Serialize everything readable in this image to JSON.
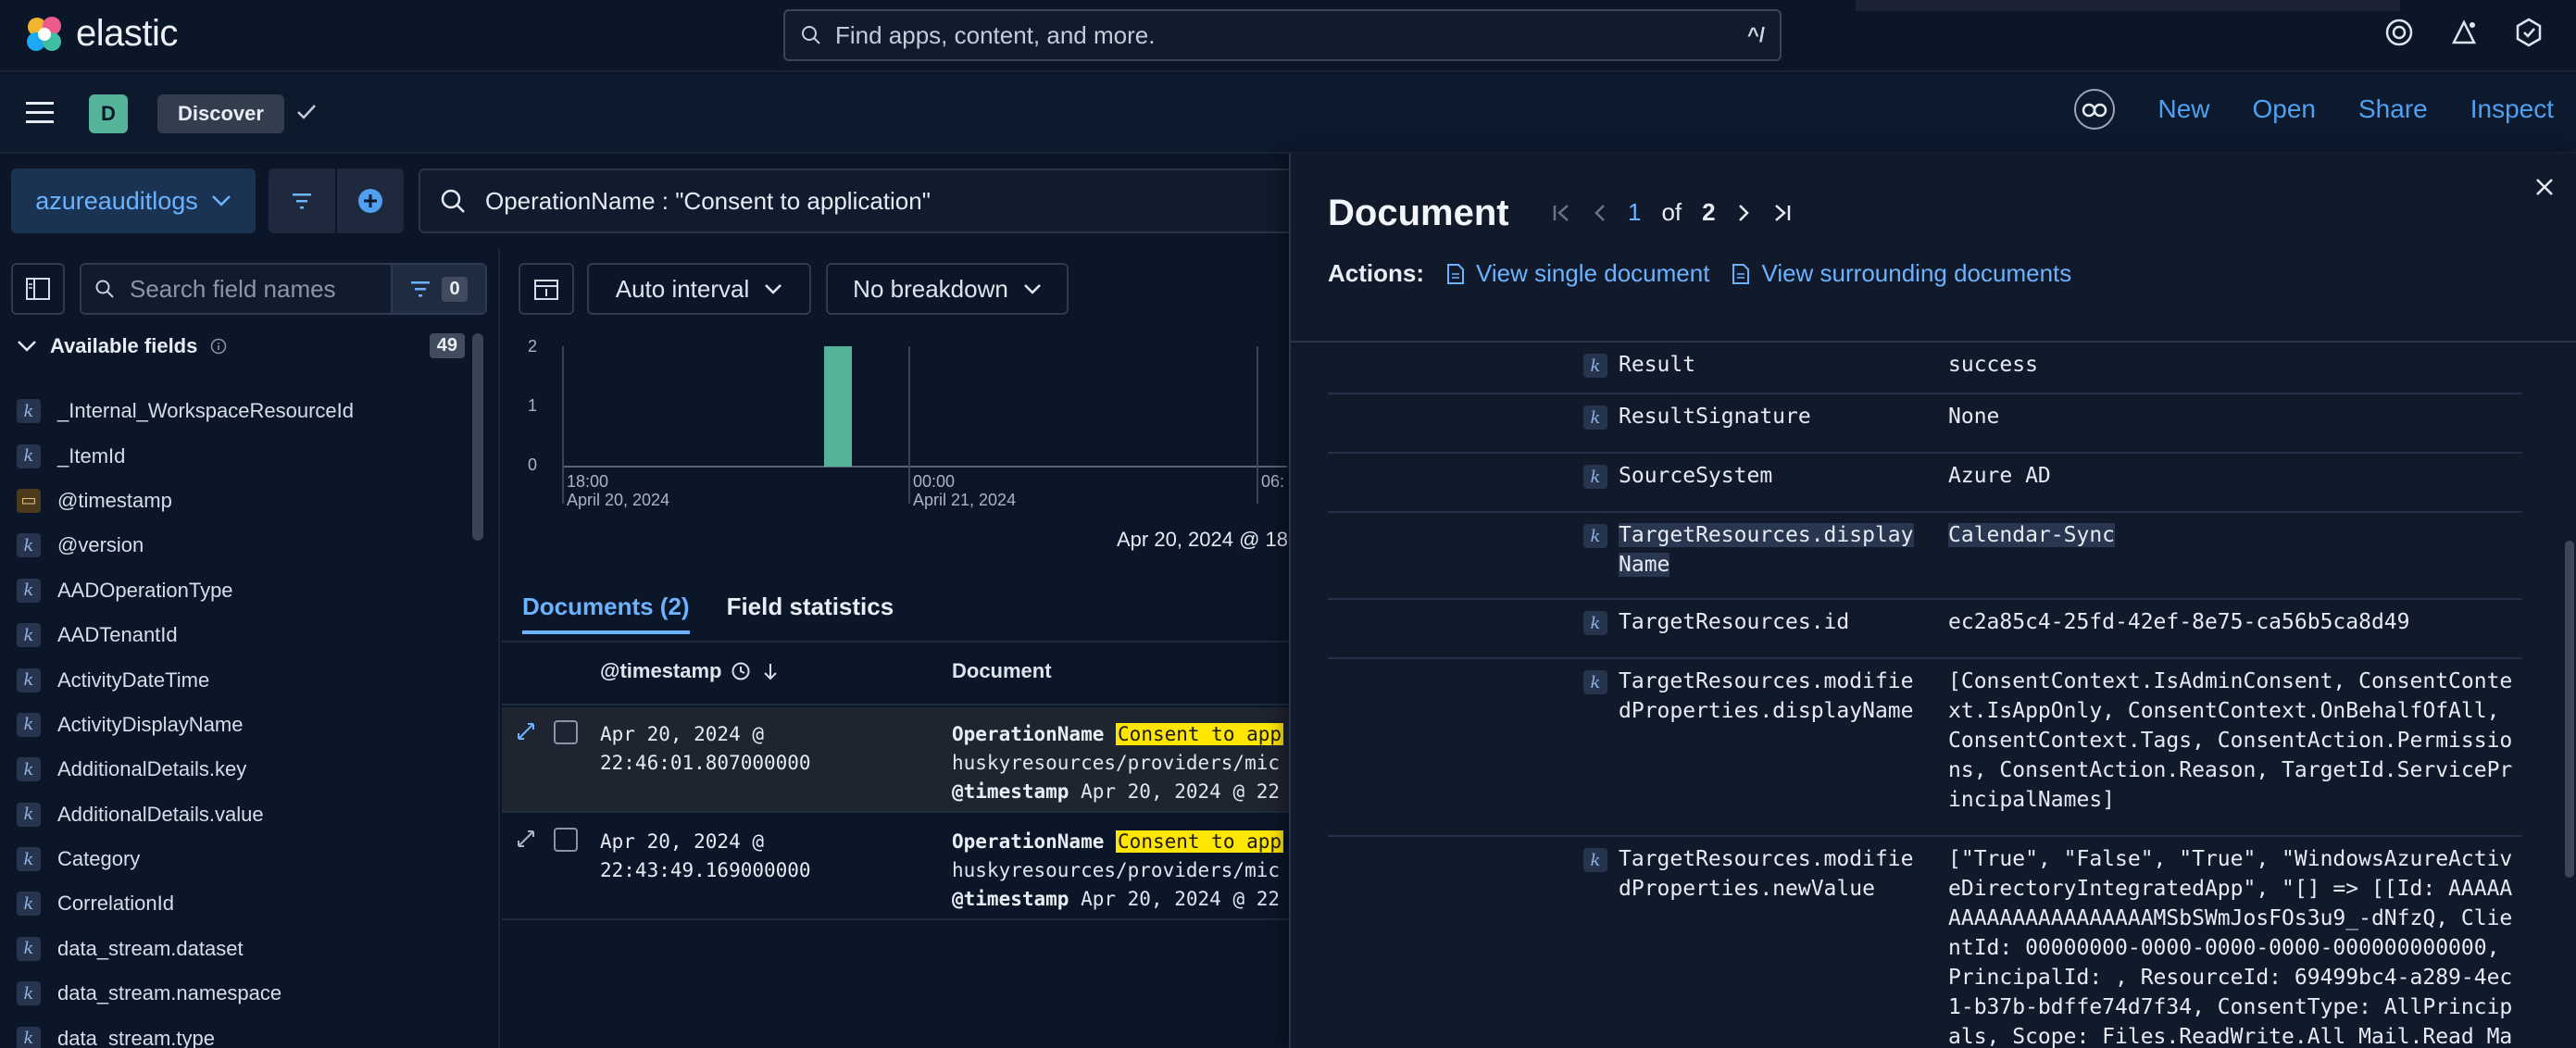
{
  "app": {
    "brand": "elastic",
    "global_search_placeholder": "Find apps, content, and more.",
    "global_search_shortcut": "^/"
  },
  "nav": {
    "space_initial": "D",
    "breadcrumb": "Discover"
  },
  "top_actions": {
    "new": "New",
    "open": "Open",
    "share": "Share",
    "inspect": "Inspect"
  },
  "query": {
    "data_view": "azureauditlogs",
    "text": "OperationName : \"Consent to application\""
  },
  "sidebar": {
    "search_placeholder": "Search field names",
    "filter_count": "0",
    "available_label": "Available fields",
    "available_count": "49",
    "fields": [
      {
        "name": "_Internal_WorkspaceResourceId",
        "type": "k"
      },
      {
        "name": "_ItemId",
        "type": "k"
      },
      {
        "name": "@timestamp",
        "type": "date"
      },
      {
        "name": "@version",
        "type": "k"
      },
      {
        "name": "AADOperationType",
        "type": "k"
      },
      {
        "name": "AADTenantId",
        "type": "k"
      },
      {
        "name": "ActivityDateTime",
        "type": "k"
      },
      {
        "name": "ActivityDisplayName",
        "type": "k"
      },
      {
        "name": "AdditionalDetails.key",
        "type": "k"
      },
      {
        "name": "AdditionalDetails.value",
        "type": "k"
      },
      {
        "name": "Category",
        "type": "k"
      },
      {
        "name": "CorrelationId",
        "type": "k"
      },
      {
        "name": "data_stream.dataset",
        "type": "k"
      },
      {
        "name": "data_stream.namespace",
        "type": "k"
      },
      {
        "name": "data_stream.type",
        "type": "k"
      }
    ]
  },
  "chart": {
    "interval": "Auto interval",
    "breakdown": "No breakdown",
    "y_ticks": [
      "2",
      "1",
      "0"
    ],
    "x_ticks": [
      {
        "time": "18:00",
        "date": "April 20, 2024"
      },
      {
        "time": "00:00",
        "date": "April 21, 2024"
      },
      {
        "time": "06:",
        "date": ""
      }
    ],
    "time_range": "Apr 20, 2024 @ 18"
  },
  "chart_data": {
    "type": "bar",
    "x": [
      "Apr 20, 2024 22:00"
    ],
    "values": [
      2
    ],
    "ylim": [
      0,
      2
    ],
    "xlabel": "",
    "ylabel": ""
  },
  "tabs": {
    "documents": "Documents (2)",
    "field_stats": "Field statistics"
  },
  "table": {
    "col_timestamp": "@timestamp",
    "col_document": "Document",
    "rows": [
      {
        "ts1": "Apr 20, 2024 @",
        "ts2": "22:46:01.807000000",
        "op_label": "OperationName",
        "op_value": "Consent to app",
        "line2": "huskyresources/providers/mic",
        "ts_label": "@timestamp",
        "ts_value": "Apr 20, 2024 @ 22"
      },
      {
        "ts1": "Apr 20, 2024 @",
        "ts2": "22:43:49.169000000",
        "op_label": "OperationName",
        "op_value": "Consent to app",
        "line2": "huskyresources/providers/mic",
        "ts_label": "@timestamp",
        "ts_value": "Apr 20, 2024 @ 22"
      }
    ]
  },
  "flyout": {
    "title": "Document",
    "page_current": "1",
    "page_of": "of",
    "page_total": "2",
    "actions_label": "Actions:",
    "view_single": "View single document",
    "view_surrounding": "View surrounding documents",
    "rows": [
      {
        "name": "Result",
        "value": "success"
      },
      {
        "name": "ResultSignature",
        "value": "None"
      },
      {
        "name": "SourceSystem",
        "value": "Azure AD"
      },
      {
        "name": "TargetResources.displayName",
        "value": "Calendar-Sync"
      },
      {
        "name": "TargetResources.id",
        "value": "ec2a85c4-25fd-42ef-8e75-ca56b5ca8d49"
      },
      {
        "name": "TargetResources.modifiedProperties.displayName",
        "value": "[ConsentContext.IsAdminConsent, ConsentContext.IsAppOnly, ConsentContext.OnBehalfOfAll, ConsentContext.Tags, ConsentAction.Permissions, ConsentAction.Reason, TargetId.ServicePrincipalNames]"
      },
      {
        "name": "TargetResources.modifiedProperties.newValue",
        "value": "[\"True\", \"False\", \"True\", \"WindowsAzureActiveDirectoryIntegratedApp\", \"[] => [[Id: AAAAAAAAAAAAAAAAAAAAAMSbSWmJosFOs3u9_-dNfzQ, ClientId: 00000000-0000-0000-0000-000000000000, PrincipalId: , ResourceId: 69499bc4-a289-4ec1-b37b-bdffe74d7f34, ConsentType: AllPrincipals, Scope: Files.ReadWrite.All Mail.Read Mail.Read.Shared"
      }
    ]
  },
  "colors": {
    "background": "#0b1628",
    "accent": "#6cb3ff",
    "bar": "#54b399",
    "highlight": "#ffe600"
  }
}
